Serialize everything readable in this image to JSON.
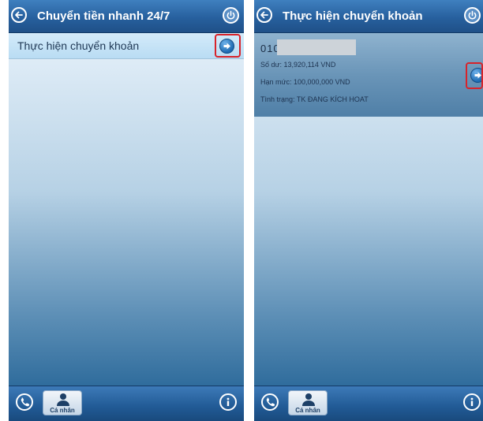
{
  "screens": [
    {
      "header": {
        "title": "Chuyển tiền nhanh 24/7"
      },
      "menu": {
        "item_label": "Thực hiện chuyển khoản"
      },
      "footer": {
        "profile_label": "Cá nhân"
      }
    },
    {
      "header": {
        "title": "Thực hiện chuyển khoản"
      },
      "account": {
        "number_prefix": "010",
        "balance": "Số dư: 13,920,114 VND",
        "limit": "Hạn mức: 100,000,000 VND",
        "status": "Tình trạng: TK ĐANG KÍCH HOAT"
      },
      "footer": {
        "profile_label": "Cá nhân"
      }
    }
  ],
  "icons": {
    "back": "back-arrow-icon",
    "power": "power-icon",
    "next": "arrow-right-icon",
    "phone": "phone-icon",
    "profile": "person-icon",
    "info": "info-icon"
  },
  "colors": {
    "header": "#27609e",
    "highlight": "#d8232a",
    "menu_item": "#c6e3f6",
    "arrow_button": "#1d6bb2"
  }
}
